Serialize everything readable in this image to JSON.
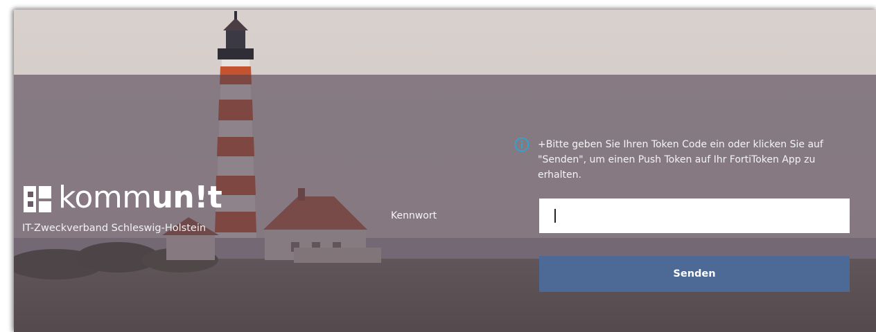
{
  "branding": {
    "logo_word_regular": "komm",
    "logo_word_bold": "un!t",
    "subtitle": "IT-Zweckverband Schleswig-Holstein"
  },
  "login": {
    "info_message": "+Bitte geben Sie Ihren Token Code ein oder klicken Sie auf \"Senden\", um einen Push Token auf Ihr FortiToken App zu erhalten.",
    "password_label": "Kennwort",
    "password_value": "",
    "send_label": "Senden"
  },
  "icons": {
    "info": "info-circle-icon"
  },
  "colors": {
    "overlay": "#4e3e50",
    "button": "#4d6a96",
    "info_icon": "#2aa6d8",
    "sky": "#d9d1cd",
    "lighthouse_red": "#c4542f"
  }
}
